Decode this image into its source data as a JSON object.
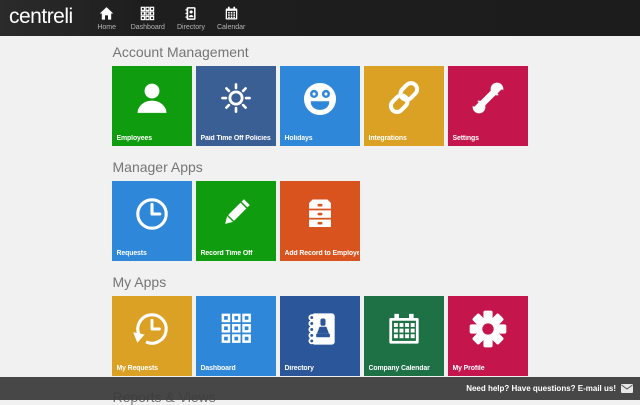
{
  "brand": {
    "logo_text": "centreli"
  },
  "topbar": {
    "bg": "#1e1e1e",
    "items": [
      {
        "label": "Home",
        "icon": "home-icon"
      },
      {
        "label": "Dashboard",
        "icon": "dashboard-grid-icon"
      },
      {
        "label": "Directory",
        "icon": "directory-book-icon"
      },
      {
        "label": "Calendar",
        "icon": "calendar-icon"
      }
    ]
  },
  "sections": [
    {
      "title": "Account Management",
      "tiles": [
        {
          "label": "Employees",
          "icon": "person-icon",
          "color": "#0f9d0f"
        },
        {
          "label": "Paid Time Off Policies",
          "icon": "sun-icon",
          "color": "#3a5f94"
        },
        {
          "label": "Holidays",
          "icon": "smiley-icon",
          "color": "#2e87d8"
        },
        {
          "label": "Integrations",
          "icon": "chain-link-icon",
          "color": "#dba125"
        },
        {
          "label": "Settings",
          "icon": "wrench-icon",
          "color": "#c4164c"
        }
      ]
    },
    {
      "title": "Manager Apps",
      "tiles": [
        {
          "label": "Requests",
          "icon": "clock-icon",
          "color": "#2e87d8"
        },
        {
          "label": "Record Time Off",
          "icon": "pencil-icon",
          "color": "#0f9d0f"
        },
        {
          "label": "Add Record to Employee",
          "icon": "file-drawers-icon",
          "color": "#d9531e"
        }
      ]
    },
    {
      "title": "My Apps",
      "tiles": [
        {
          "label": "My Requests",
          "icon": "history-clock-icon",
          "color": "#dba125"
        },
        {
          "label": "Dashboard",
          "icon": "dashboard-grid-icon",
          "color": "#2e87d8"
        },
        {
          "label": "Directory",
          "icon": "notebook-contact-icon",
          "color": "#2b579a"
        },
        {
          "label": "Company Calendar",
          "icon": "calendar-icon",
          "color": "#1e7145"
        },
        {
          "label": "My Profile",
          "icon": "gear-icon",
          "color": "#c4164c"
        }
      ]
    },
    {
      "title": "Reports & Views",
      "tiles": []
    }
  ],
  "footer": {
    "help_text": "Need help? Have questions? E-mail us!",
    "icon": "envelope-icon"
  }
}
